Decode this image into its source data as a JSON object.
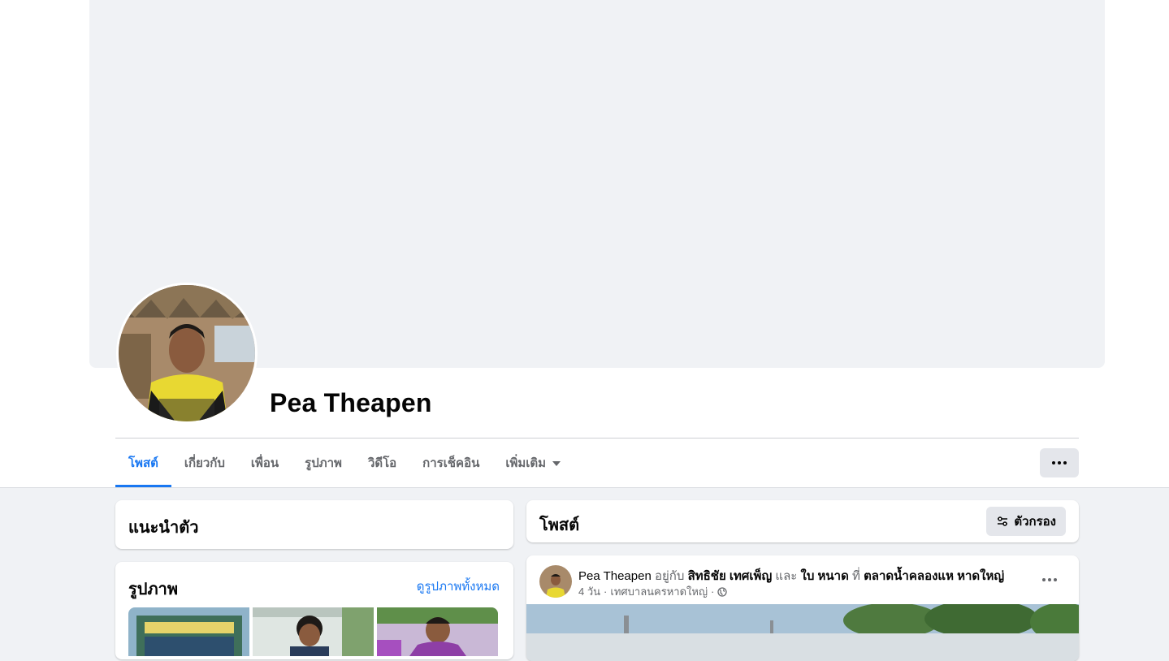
{
  "profile": {
    "name": "Pea Theapen"
  },
  "tabs": [
    {
      "label": "โพสต์",
      "active": true
    },
    {
      "label": "เกี่ยวกับ"
    },
    {
      "label": "เพื่อน"
    },
    {
      "label": "รูปภาพ"
    },
    {
      "label": "วิดีโอ"
    },
    {
      "label": "การเช็คอิน"
    },
    {
      "label": "เพิ่มเติม"
    }
  ],
  "intro": {
    "title": "แนะนำตัว"
  },
  "photos": {
    "title": "รูปภาพ",
    "see_all": "ดูรูปภาพทั้งหมด"
  },
  "posts": {
    "title": "โพสต์",
    "filter_label": "ตัวกรอง"
  },
  "post": {
    "author": "Pea Theapen",
    "with_word": "อยู่กับ",
    "tagged_1": "สิทธิชัย เทศเพ็ญ",
    "and_word": "และ",
    "tagged_2": "ใบ หนาด",
    "at_word": "ที่",
    "place": "ตลาดน้ำคลองแห หาดใหญ่",
    "time": "4 วัน",
    "location": "เทศบาลนครหาดใหญ่",
    "separator": "·"
  },
  "colors": {
    "accent": "#1877f2",
    "page_bg": "#f0f2f5",
    "secondary_text": "#65676b"
  },
  "icons": [
    "more-dots-icon",
    "filter-icon",
    "globe-icon",
    "dropdown-caret-icon"
  ]
}
